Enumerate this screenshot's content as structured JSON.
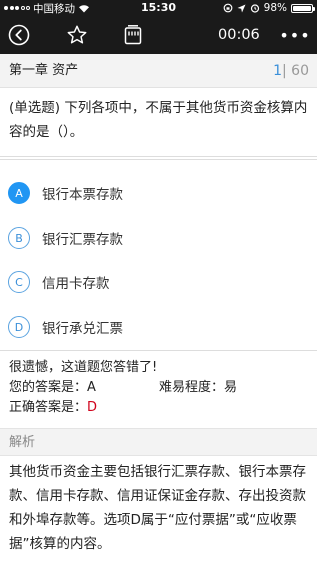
{
  "status_bar": {
    "carrier": "中国移动",
    "time": "15:30",
    "battery": "98%",
    "battery_level": 0.98,
    "icons": [
      "signal-dots-icon",
      "wifi-icon",
      "rotation-lock-icon",
      "location-icon",
      "alarm-icon",
      "battery-icon"
    ]
  },
  "nav": {
    "icons": [
      "back-icon",
      "star-icon",
      "answer-card-icon",
      "more-icon"
    ],
    "timer": "00:06",
    "more": "•••"
  },
  "chapter": {
    "title": "第一章 资产",
    "current": "1",
    "total": "60"
  },
  "question": {
    "text": "(单选题) 下列各项中，不属于其他货币资金核算内容的是（）。"
  },
  "options": [
    {
      "letter": "A",
      "text": "银行本票存款",
      "selected": true
    },
    {
      "letter": "B",
      "text": "银行汇票存款",
      "selected": false
    },
    {
      "letter": "C",
      "text": "信用卡存款",
      "selected": false
    },
    {
      "letter": "D",
      "text": "银行承兑汇票",
      "selected": false
    }
  ],
  "result": {
    "message": "很遗憾，这道题您答错了!",
    "your_answer_label": "您的答案是：",
    "your_answer": "A",
    "difficulty_label": "难易程度：",
    "difficulty": "易",
    "correct_label": "正确答案是：",
    "correct_answer": "D"
  },
  "analysis": {
    "label": "解析",
    "text": "其他货币资金主要包括银行汇票存款、银行本票存款、信用卡存款、信用证保证金存款、存出投资款和外埠存款等。选项D属于“应付票据”或“应收票据”核算的内容。"
  },
  "colors": {
    "accent": "#2196f3",
    "wrong": "#d0021b",
    "header_bg": "#1a1a1a"
  }
}
